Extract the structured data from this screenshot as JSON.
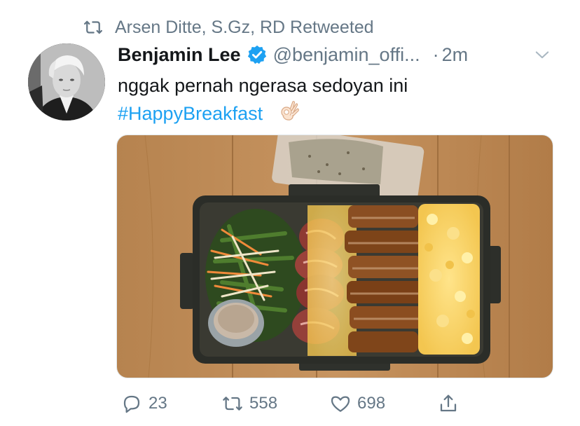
{
  "retweet_context": {
    "icon": "retweet-icon",
    "text": "Arsen Ditte, S.Gz, RD Retweeted"
  },
  "tweet": {
    "author_name": "Benjamin Lee",
    "verified": true,
    "handle": "@benjamin_offi...",
    "separator": "·",
    "time": "2m",
    "text": "nggak pernah ngerasa sedoyan ini",
    "hashtag": "#HappyBreakfast",
    "emoji": "ok-hand-emoji",
    "media": "bento-box-photo"
  },
  "actions": {
    "reply_count": "23",
    "retweet_count": "558",
    "like_count": "698"
  },
  "colors": {
    "link": "#1da1f2",
    "muted": "#657786",
    "text": "#14171a"
  }
}
